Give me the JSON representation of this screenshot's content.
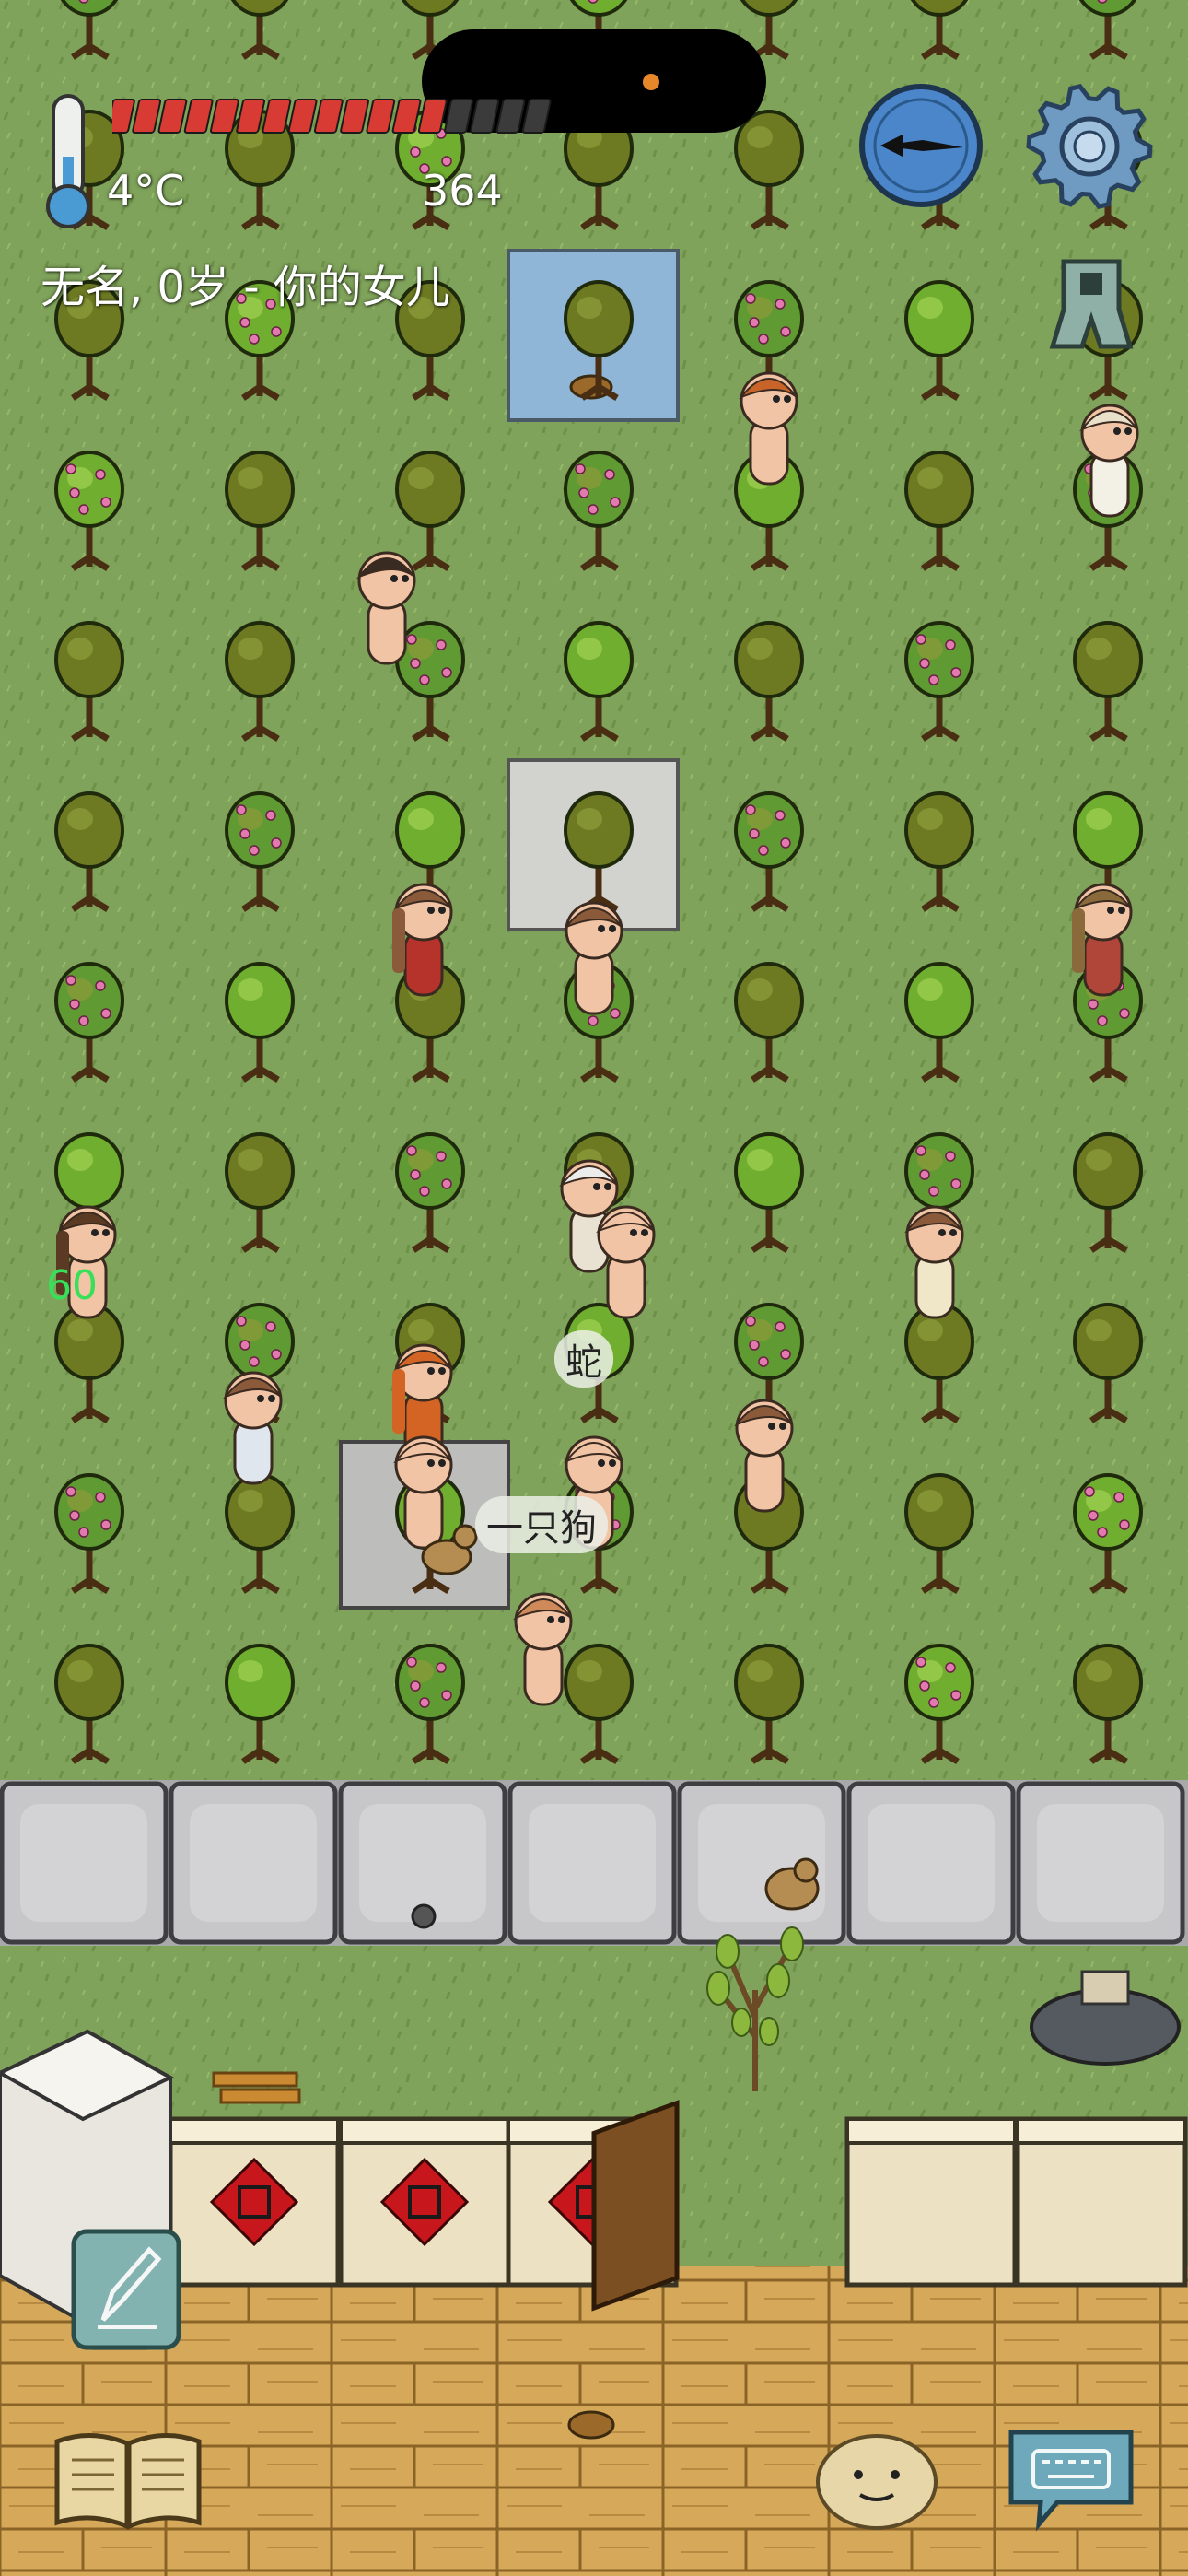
{
  "hud": {
    "temperature": "4°C",
    "food_counter": "364",
    "identity": "无名, 0岁 - 你的女儿",
    "food_pips_total": 17,
    "food_pips_filled": 13,
    "hunger_color": "#d83a34"
  },
  "world_labels": {
    "snake_label": "蛇",
    "dog_label": "一只狗",
    "age_number": "60"
  },
  "icons": {
    "compass": "compass-icon",
    "settings": "gear-icon",
    "coin": "ancient-coin-icon",
    "pencil": "pencil-icon",
    "book": "book-icon",
    "emote": "emote-face-icon",
    "keyboard": "keyboard-icon"
  },
  "colors": {
    "grass": "#7fa35a",
    "stone_floor": "#c9c9c9",
    "water": "#8fb6d6",
    "wall_stone": "#b8b8b8",
    "wall_plaster": "#ece1c2",
    "wood_floor": "#d5a85a",
    "fu_red": "#c7171d"
  }
}
